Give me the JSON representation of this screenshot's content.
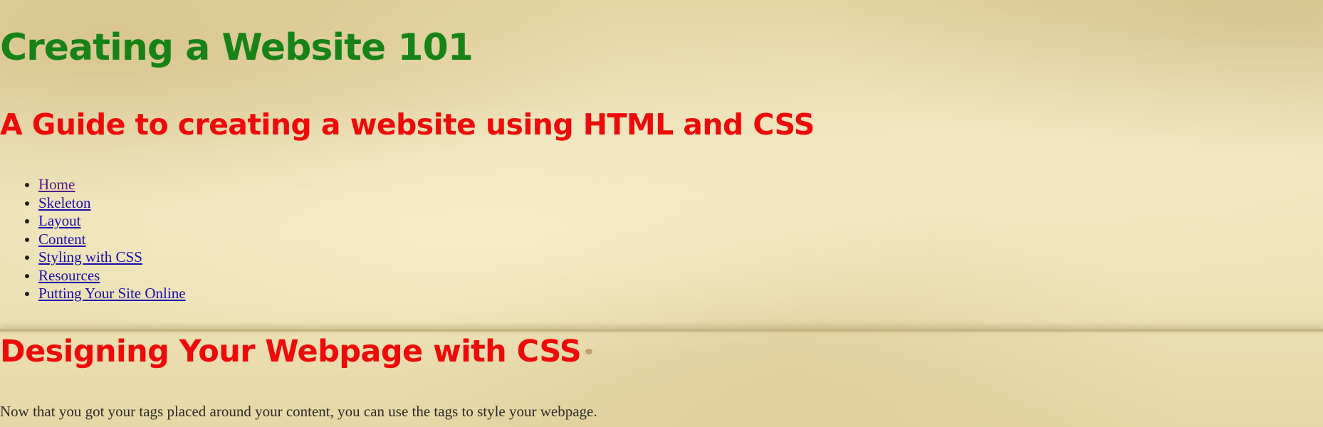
{
  "header": {
    "title": "Creating a Website 101",
    "subtitle": "A Guide to creating a website using HTML and CSS"
  },
  "nav": {
    "items": [
      {
        "label": "Home"
      },
      {
        "label": "Skeleton"
      },
      {
        "label": "Layout"
      },
      {
        "label": "Content"
      },
      {
        "label": "Styling with CSS"
      },
      {
        "label": "Resources"
      },
      {
        "label": "Putting Your Site Online"
      }
    ]
  },
  "main": {
    "section_title": "Designing Your Webpage with CSS",
    "paragraph": "Now that you got your tags placed around your content, you can use the tags to style your webpage."
  },
  "colors": {
    "title": "#178317",
    "heading": "#ee0a0a",
    "link": "#1a0dab",
    "visited_link": "#551a8b",
    "background": "#ede0b4"
  }
}
